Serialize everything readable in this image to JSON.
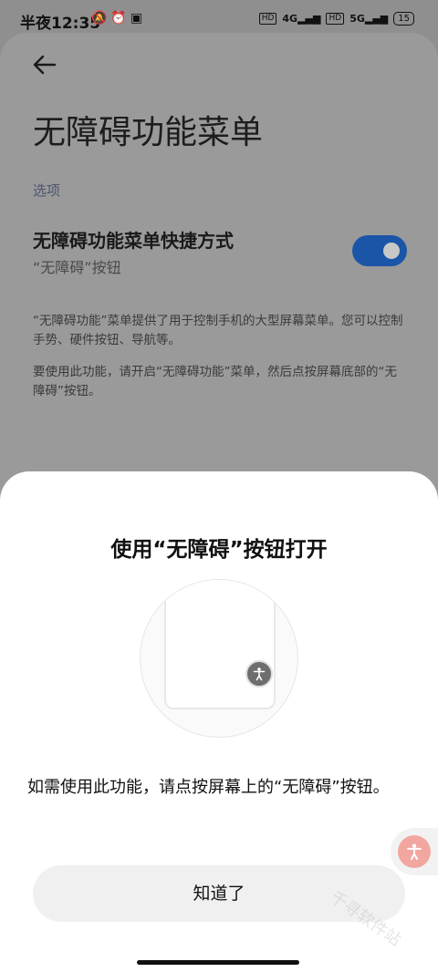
{
  "status_bar": {
    "time": "半夜12:35",
    "left_icons": [
      "mute-icon",
      "alarm-icon",
      "app-notification-icon"
    ],
    "left_icons_glyphs": "🔕⏰▣",
    "hd1": "HD",
    "net1": "4G",
    "hd2": "HD",
    "net2": "5G",
    "battery": "15"
  },
  "page": {
    "title": "无障碍功能菜单",
    "section": "选项",
    "shortcut_title": "无障碍功能菜单快捷方式",
    "shortcut_subtitle": "“无障碍”按钮",
    "toggle_on": true,
    "description_1": "“无障碍功能”菜单提供了用于控制手机的大型屏幕菜单。您可以控制手势、硬件按钮、导航等。",
    "description_2": "要使用此功能，请开启“无障碍功能”菜单，然后点按屏幕底部的“无障碍”按钮。"
  },
  "sheet": {
    "title": "使用“无障碍”按钮打开",
    "instruction": "如需使用此功能，请点按屏幕上的“无障碍”按钮。",
    "button_label": "知道了"
  },
  "watermark": "千寻软件站",
  "colors": {
    "accent": "#1a55a8",
    "floating_button": "#f1a7a0"
  }
}
